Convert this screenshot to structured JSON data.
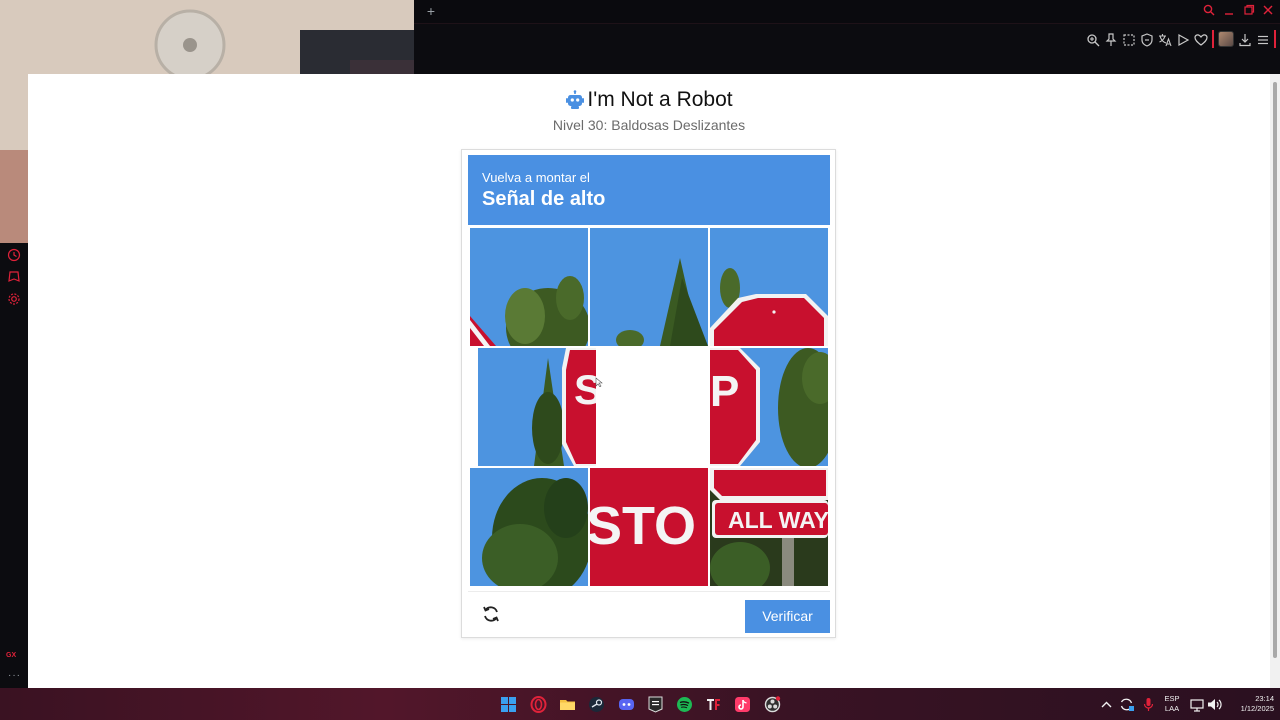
{
  "page": {
    "title": "I'm Not a Robot",
    "subtitle": "Nivel 30: Baldosas Deslizantes"
  },
  "captcha": {
    "instruction": "Vuelva a montar el",
    "target": "Señal de alto",
    "tiles": [
      {
        "position": 1,
        "content": "sky-trees-sign-corner"
      },
      {
        "position": 2,
        "content": "sky-tree-top"
      },
      {
        "position": 3,
        "content": "stop-sign-top"
      },
      {
        "position": 4,
        "content": "sky-tree-sign-S"
      },
      {
        "position": 5,
        "content": "empty"
      },
      {
        "position": 6,
        "content": "stop-sign-P"
      },
      {
        "position": 7,
        "content": "green-tree"
      },
      {
        "position": 8,
        "content": "stop-sign-STO"
      },
      {
        "position": 9,
        "content": "all-way-sign"
      }
    ],
    "tile_texts": {
      "s_letter": "S",
      "p_letter": "P",
      "sto": "STO",
      "all_way": "ALL WAY"
    },
    "refresh_icon": "refresh-icon",
    "verify_label": "Verificar"
  },
  "tray": {
    "lang_line1": "ESP",
    "lang_line2": "LAA",
    "time": "23:14",
    "date": "1/12/2025"
  },
  "taskbar_apps": [
    "windows-start",
    "opera-gx",
    "file-explorer",
    "steam",
    "discord",
    "epic-games",
    "spotify",
    "typeform",
    "tiktok",
    "obs"
  ],
  "colors": {
    "accent": "#e0223a",
    "captcha_blue": "#4a90e2",
    "stop_red": "#c8102e"
  }
}
